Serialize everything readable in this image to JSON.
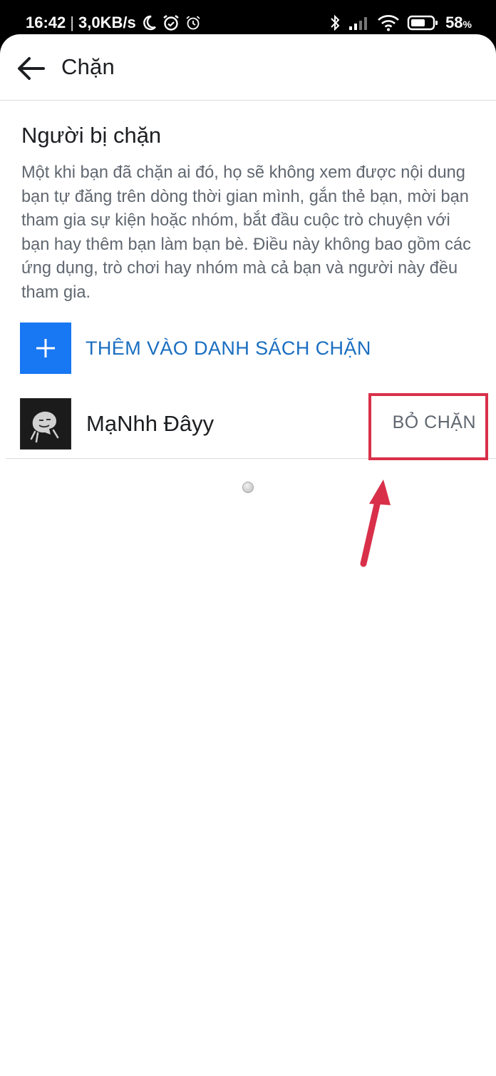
{
  "status_bar": {
    "time": "16:42",
    "separator": "|",
    "speed": "3,0KB/s",
    "battery_percent": "58",
    "battery_unit": "%",
    "icons": [
      "moon-icon",
      "alarm-icon",
      "alarm-outline-icon",
      "bluetooth-icon",
      "signal-icon",
      "wifi-icon",
      "battery-icon"
    ]
  },
  "header": {
    "back_icon": "arrow-left-icon",
    "title": "Chặn"
  },
  "section": {
    "title": "Người bị chặn",
    "description": "Một khi bạn đã chặn ai đó, họ sẽ không xem được nội dung bạn tự đăng trên dòng thời gian mình, gắn thẻ bạn, mời bạn tham gia sự kiện hoặc nhóm, bắt đầu cuộc trò chuyện với bạn hay thêm bạn làm bạn bè. Điều này không bao gồm các ứng dụng, trò chơi hay nhóm mà cả bạn và người này đều tham gia."
  },
  "add_block": {
    "icon": "plus-icon",
    "label": "THÊM VÀO DANH SÁCH CHẶN"
  },
  "blocked_users": [
    {
      "name": "MạNhh Đâyy",
      "action_label": "BỎ CHẶN",
      "avatar_icon": "meme-face-avatar"
    }
  ],
  "annotation": {
    "highlight_color": "#d9304a",
    "arrow_color": "#d9304a"
  },
  "colors": {
    "accent_blue": "#1877f2",
    "link_blue": "#1a6ec1",
    "text_primary": "#1c1e21",
    "text_secondary": "#606770"
  }
}
